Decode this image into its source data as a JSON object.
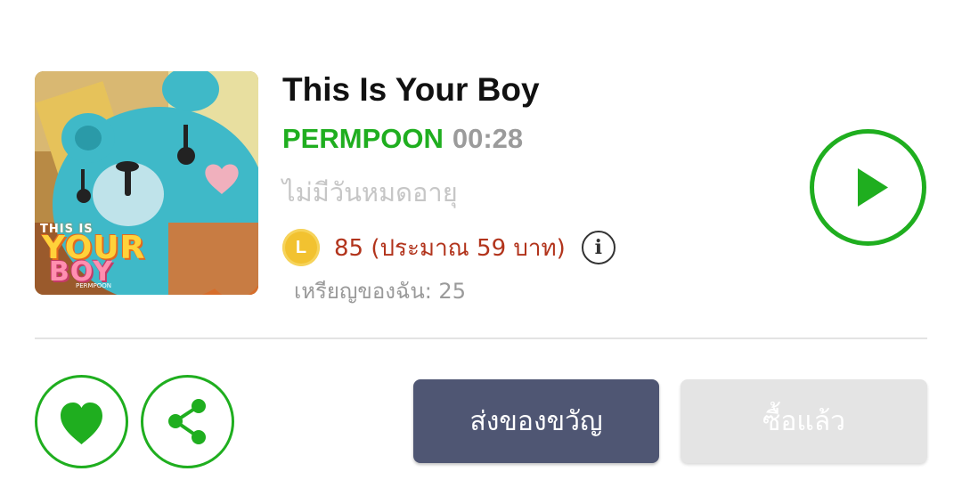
{
  "product": {
    "cover_alt_text": {
      "line1": "THIS IS",
      "line2": "YOUR",
      "line3": "BOY",
      "signature": "PERMPOON"
    },
    "title": "This Is Your Boy",
    "artist": "PERMPOON",
    "duration": "00:28",
    "validity": "ไม่มีวันหมดอายุ",
    "price_text": "85 (ประมาณ 59 บาท)",
    "coin_symbol": "L",
    "info_symbol": "i",
    "my_coins": "เหรียญของฉัน: 25"
  },
  "actions": {
    "play_icon": "play-icon",
    "like_icon": "heart-icon",
    "share_icon": "share-icon",
    "gift_label": "ส่งของขวัญ",
    "bought_label": "ซื้อแล้ว"
  },
  "colors": {
    "accent_green": "#1fae1f",
    "price_red": "#b2341c",
    "gift_button": "#4f5673",
    "disabled_button": "#e4e4e4",
    "coin_gold": "#f2c230"
  }
}
